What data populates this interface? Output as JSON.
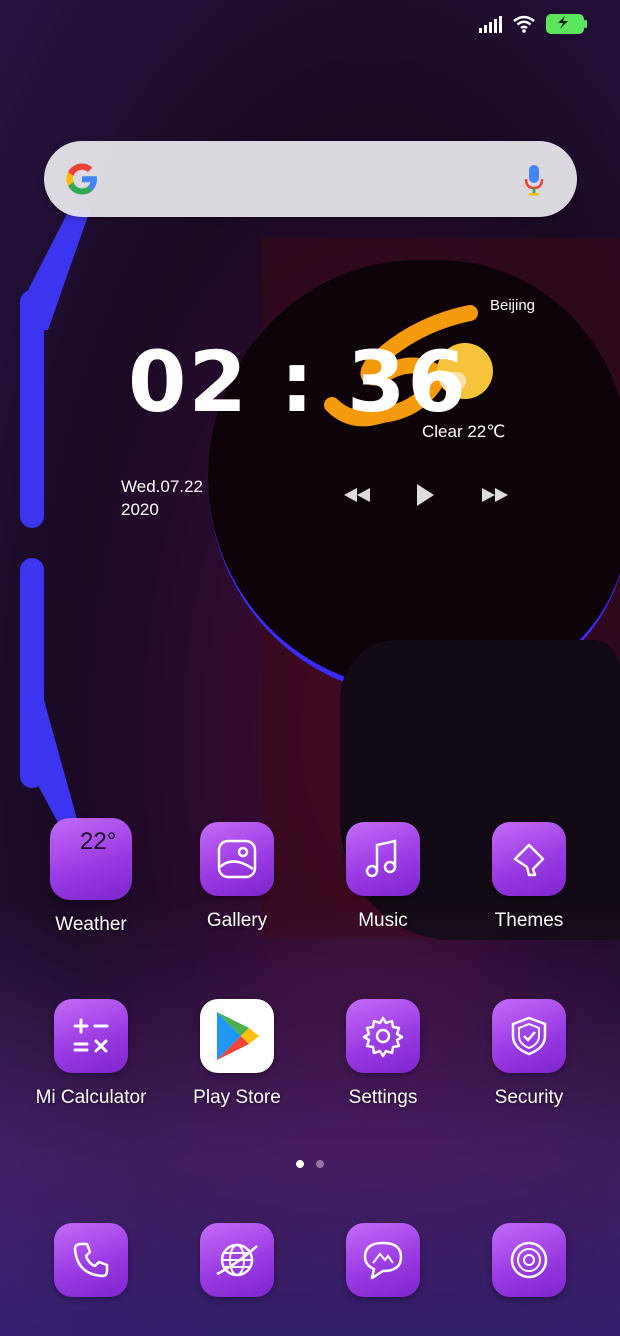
{
  "status": {
    "icons": [
      "signal-icon",
      "wifi-icon",
      "battery-charging-icon"
    ]
  },
  "search": {
    "icons": [
      "google-logo",
      "microphone-icon"
    ]
  },
  "clock_widget": {
    "time": "02 : 36",
    "date_line1": "Wed.07.22",
    "date_line2": "2020",
    "media_controls": [
      "rewind-icon",
      "play-icon",
      "fast-forward-icon"
    ]
  },
  "weather_widget": {
    "city": "Beijing",
    "condition": "Clear  22℃"
  },
  "apps_row1": [
    {
      "label": "Weather",
      "badge": "22°"
    },
    {
      "label": "Gallery"
    },
    {
      "label": "Music"
    },
    {
      "label": "Themes"
    }
  ],
  "apps_row2": [
    {
      "label": "Mi Calculator"
    },
    {
      "label": "Play Store"
    },
    {
      "label": "Settings"
    },
    {
      "label": "Security"
    }
  ],
  "dock": [
    "phone-icon",
    "browser-icon",
    "messages-icon",
    "camera-icon"
  ],
  "page_indicator": {
    "pages": 2,
    "current": 1
  },
  "colors": {
    "accent_purple": "#9b3be3",
    "wallpaper_blue": "#3b35f0",
    "sun": "#f6c33b",
    "battery": "#5be65b"
  }
}
